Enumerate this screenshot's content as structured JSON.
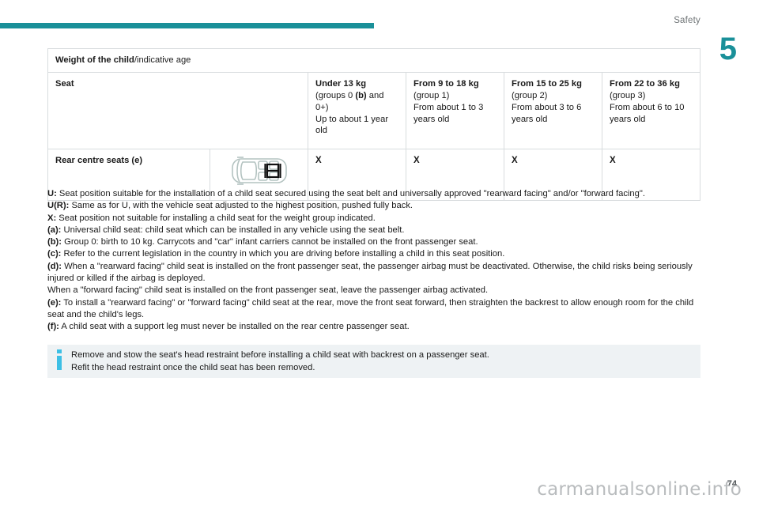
{
  "header": {
    "section_label": "Safety",
    "chapter_number": "5",
    "rule_color": "#1a9099"
  },
  "table": {
    "title_bold": "Weight of the child",
    "title_rest": "/indicative age",
    "seat_column_header": "Seat",
    "group_columns": [
      {
        "weight": "Under 13 kg",
        "group_line_a": "(groups 0 ",
        "group_bold": "(b)",
        "group_line_b": " and 0+)",
        "age": "Up to about 1 year old"
      },
      {
        "weight": "From 9 to 18 kg",
        "group": "(group 1)",
        "age": "From about 1 to 3 years old"
      },
      {
        "weight": "From 15 to 25 kg",
        "group": "(group 2)",
        "age": "From about 3 to 6 years old"
      },
      {
        "weight": "From 22 to 36 kg",
        "group": "(group 3)",
        "age": "From about 6 to 10 years old"
      }
    ],
    "rows": [
      {
        "label": "Rear centre seats (e)",
        "diagram": "car-top-view-rear-centre-seat-icon",
        "marks": [
          "X",
          "X",
          "X",
          "X"
        ]
      }
    ]
  },
  "footnotes": [
    {
      "key": "U:",
      "text": " Seat position suitable for the installation of a child seat secured using the seat belt and universally approved \"rearward facing\" and/or \"forward facing\"."
    },
    {
      "key": "U(R):",
      "text": " Same as for U, with the vehicle seat adjusted to the highest position, pushed fully back."
    },
    {
      "key": "X:",
      "text": " Seat position not suitable for installing a child seat for the weight group indicated."
    },
    {
      "key": "(a):",
      "text": " Universal child seat: child seat which can be installed in any vehicle using the seat belt."
    },
    {
      "key": "(b):",
      "text": " Group 0: birth to 10 kg. Carrycots and \"car\" infant carriers cannot be installed on the front passenger seat."
    },
    {
      "key": "(c):",
      "text": " Refer to the current legislation in the country in which you are driving before installing a child in this seat position."
    },
    {
      "key": "(d):",
      "text": " When a \"rearward facing\" child seat is installed on the front passenger seat, the passenger airbag must be deactivated. Otherwise, the child risks being seriously injured or killed if the airbag is deployed."
    },
    {
      "key": "",
      "text": "When a \"forward facing\" child seat is installed on the front passenger seat, leave the passenger airbag activated."
    },
    {
      "key": "(e):",
      "text": " To install a \"rearward facing\" or \"forward facing\" child seat at the rear, move the front seat forward, then straighten the backrest to allow enough room for the child seat and the child's legs."
    },
    {
      "key": "(f):",
      "text": " A child seat with a support leg must never be installed on the rear centre passenger seat."
    }
  ],
  "info_box": {
    "icon": "info-icon",
    "icon_color": "#3cbfe5",
    "background": "#eef2f4",
    "lines": [
      "Remove and stow the seat's head restraint before installing a child seat with backrest on a passenger seat.",
      "Refit the head restraint once the child seat has been removed."
    ]
  },
  "footer": {
    "page_number": "74",
    "watermark": "carmanualsonline.info"
  }
}
